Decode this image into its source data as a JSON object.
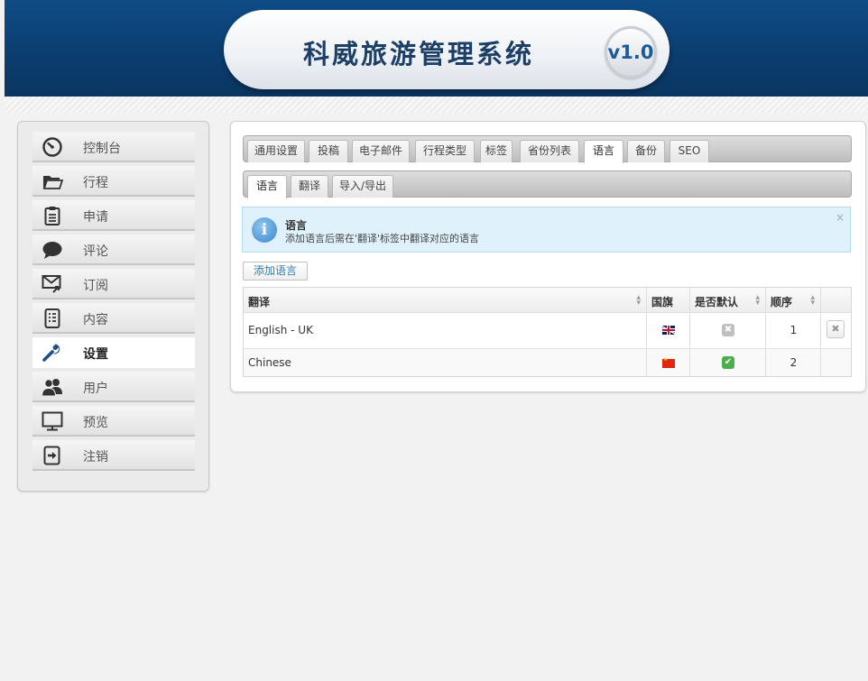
{
  "app": {
    "title": "科威旅游管理系统",
    "version": "v1.0"
  },
  "sidebar": {
    "items": [
      {
        "label": "控制台",
        "icon": "dashboard-icon"
      },
      {
        "label": "行程",
        "icon": "folder-icon"
      },
      {
        "label": "申请",
        "icon": "clipboard-icon"
      },
      {
        "label": "评论",
        "icon": "comment-icon"
      },
      {
        "label": "订阅",
        "icon": "mail-icon"
      },
      {
        "label": "内容",
        "icon": "document-icon"
      },
      {
        "label": "设置",
        "icon": "wrench-icon",
        "active": true
      },
      {
        "label": "用户",
        "icon": "users-icon"
      },
      {
        "label": "预览",
        "icon": "monitor-icon"
      },
      {
        "label": "注销",
        "icon": "logout-icon"
      }
    ]
  },
  "main_tabs": [
    {
      "label": "通用设置"
    },
    {
      "label": "投稿"
    },
    {
      "label": "电子邮件"
    },
    {
      "label": "行程类型"
    },
    {
      "label": "标签"
    },
    {
      "label": "省份列表"
    },
    {
      "label": "语言",
      "active": true
    },
    {
      "label": "备份"
    },
    {
      "label": "SEO"
    }
  ],
  "sub_tabs": [
    {
      "label": "语言",
      "active": true
    },
    {
      "label": "翻译"
    },
    {
      "label": "导入/导出"
    }
  ],
  "info": {
    "title": "语言",
    "description": "添加语言后需在'翻译'标签中翻译对应的语言",
    "close": "×"
  },
  "add_button": "添加语言",
  "table": {
    "headers": [
      "翻译",
      "国旗",
      "是否默认",
      "顺序"
    ],
    "rows": [
      {
        "name": "English - UK",
        "flag": "uk",
        "default": false,
        "order": "1",
        "deletable": true
      },
      {
        "name": "Chinese",
        "flag": "cn",
        "default": true,
        "order": "2",
        "deletable": false
      }
    ]
  },
  "colors": {
    "header_blue": "#0b3e70",
    "accent_text": "#2d7db3",
    "default_on": "#4cae4c",
    "default_off": "#bfbfbf",
    "info_bg": "#dff1fa"
  }
}
